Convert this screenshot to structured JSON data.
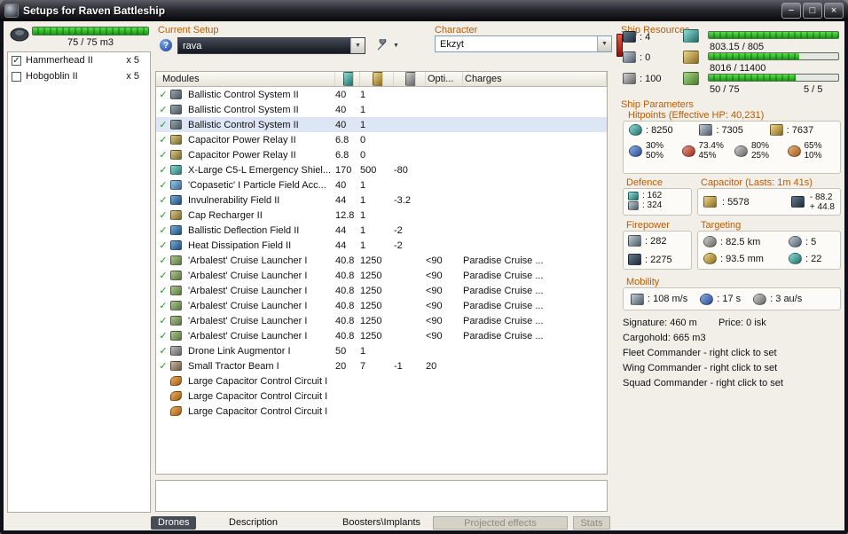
{
  "window": {
    "title": "Setups for Raven Battleship"
  },
  "icons": {
    "help": "?",
    "dropdown_arrow": "▼",
    "checkmark": "✓",
    "minimize": "−",
    "maximize": "□",
    "close": "×"
  },
  "drone_bay": {
    "capacity": "75 / 75 m3",
    "fill_percent": 100,
    "items": [
      {
        "name": "Hammerhead II",
        "qty": "x 5",
        "checked": true
      },
      {
        "name": "Hobgoblin II",
        "qty": "x 5",
        "checked": false
      }
    ]
  },
  "current_setup": {
    "label": "Current Setup",
    "value": "rava"
  },
  "character": {
    "label": "Character",
    "value": "Ekzyt"
  },
  "ship_resources": {
    "label": "Ship Resources",
    "slots": [
      {
        "value": ": 4"
      },
      {
        "value": ": 0"
      },
      {
        "value": ": 100"
      }
    ],
    "bars": [
      {
        "value": "803.15 / 805",
        "percent": 100
      },
      {
        "value": "8016 / 11400",
        "percent": 70
      },
      {
        "value": "50 / 75",
        "percent": 67
      }
    ],
    "rig_slots": "5 / 5"
  },
  "modules": {
    "headers": {
      "modules": "Modules",
      "opti": "Opti...",
      "charges": "Charges"
    },
    "rows": [
      {
        "checked": true,
        "icon": "bcs",
        "name": "Ballistic Control System II",
        "cpu": "40",
        "pg": "1",
        "cap": "",
        "opti": "",
        "charges": ""
      },
      {
        "checked": true,
        "icon": "bcs",
        "name": "Ballistic Control System II",
        "cpu": "40",
        "pg": "1",
        "cap": "",
        "opti": "",
        "charges": ""
      },
      {
        "checked": true,
        "icon": "bcs",
        "name": "Ballistic Control System II",
        "cpu": "40",
        "pg": "1",
        "cap": "",
        "opti": "",
        "charges": "",
        "selected": true
      },
      {
        "checked": true,
        "icon": "cpr",
        "name": "Capacitor Power Relay II",
        "cpu": "6.8",
        "pg": "0",
        "cap": "",
        "opti": "",
        "charges": ""
      },
      {
        "checked": true,
        "icon": "cpr",
        "name": "Capacitor Power Relay II",
        "cpu": "6.8",
        "pg": "0",
        "cap": "",
        "opti": "",
        "charges": ""
      },
      {
        "checked": true,
        "icon": "shield-booster",
        "name": "X-Large C5-L Emergency Shiel...",
        "cpu": "170",
        "pg": "500",
        "cap": "-80",
        "opti": "",
        "charges": ""
      },
      {
        "checked": true,
        "icon": "shield-mod",
        "name": "'Copasetic' I Particle Field Acc...",
        "cpu": "40",
        "pg": "1",
        "cap": "",
        "opti": "",
        "charges": ""
      },
      {
        "checked": true,
        "icon": "hardener",
        "name": "Invulnerability Field II",
        "cpu": "44",
        "pg": "1",
        "cap": "-3.2",
        "opti": "",
        "charges": ""
      },
      {
        "checked": true,
        "icon": "cpr",
        "name": "Cap Recharger II",
        "cpu": "12.8",
        "pg": "1",
        "cap": "",
        "opti": "",
        "charges": ""
      },
      {
        "checked": true,
        "icon": "hardener",
        "name": "Ballistic Deflection Field II",
        "cpu": "44",
        "pg": "1",
        "cap": "-2",
        "opti": "",
        "charges": ""
      },
      {
        "checked": true,
        "icon": "hardener",
        "name": "Heat Dissipation Field II",
        "cpu": "44",
        "pg": "1",
        "cap": "-2",
        "opti": "",
        "charges": ""
      },
      {
        "checked": true,
        "icon": "launcher",
        "name": "'Arbalest' Cruise Launcher I",
        "cpu": "40.8",
        "pg": "1250",
        "cap": "",
        "opti": "<90",
        "charges": "Paradise Cruise ..."
      },
      {
        "checked": true,
        "icon": "launcher",
        "name": "'Arbalest' Cruise Launcher I",
        "cpu": "40.8",
        "pg": "1250",
        "cap": "",
        "opti": "<90",
        "charges": "Paradise Cruise ..."
      },
      {
        "checked": true,
        "icon": "launcher",
        "name": "'Arbalest' Cruise Launcher I",
        "cpu": "40.8",
        "pg": "1250",
        "cap": "",
        "opti": "<90",
        "charges": "Paradise Cruise ..."
      },
      {
        "checked": true,
        "icon": "launcher",
        "name": "'Arbalest' Cruise Launcher I",
        "cpu": "40.8",
        "pg": "1250",
        "cap": "",
        "opti": "<90",
        "charges": "Paradise Cruise ..."
      },
      {
        "checked": true,
        "icon": "launcher",
        "name": "'Arbalest' Cruise Launcher I",
        "cpu": "40.8",
        "pg": "1250",
        "cap": "",
        "opti": "<90",
        "charges": "Paradise Cruise ..."
      },
      {
        "checked": true,
        "icon": "launcher",
        "name": "'Arbalest' Cruise Launcher I",
        "cpu": "40.8",
        "pg": "1250",
        "cap": "",
        "opti": "<90",
        "charges": "Paradise Cruise ..."
      },
      {
        "checked": true,
        "icon": "drone-link",
        "name": "Drone Link Augmentor I",
        "cpu": "50",
        "pg": "1",
        "cap": "",
        "opti": "",
        "charges": ""
      },
      {
        "checked": true,
        "icon": "tractor",
        "name": "Small Tractor Beam I",
        "cpu": "20",
        "pg": "7",
        "cap": "-1",
        "opti": "20",
        "charges": ""
      },
      {
        "checked": false,
        "icon": "rig",
        "name": "Large Capacitor Control Circuit I",
        "cpu": "",
        "pg": "",
        "cap": "",
        "opti": "",
        "charges": ""
      },
      {
        "checked": false,
        "icon": "rig",
        "name": "Large Capacitor Control Circuit I",
        "cpu": "",
        "pg": "",
        "cap": "",
        "opti": "",
        "charges": ""
      },
      {
        "checked": false,
        "icon": "rig",
        "name": "Large Capacitor Control Circuit I",
        "cpu": "",
        "pg": "",
        "cap": "",
        "opti": "",
        "charges": ""
      }
    ]
  },
  "ship_parameters": {
    "label": "Ship Parameters",
    "hitpoints": {
      "label": "Hitpoints (Effective HP: 40,231)",
      "hp": [
        {
          "value": ": 8250"
        },
        {
          "value": ": 7305"
        },
        {
          "value": ": 7637"
        }
      ],
      "resists": [
        {
          "top": "30%",
          "bottom": "50%"
        },
        {
          "top": "73.4%",
          "bottom": "45%"
        },
        {
          "top": "80%",
          "bottom": "25%"
        },
        {
          "top": "65%",
          "bottom": "10%"
        }
      ]
    },
    "defence": {
      "label": "Defence",
      "shield_recharge": ": 162",
      "passive_defence": ": 324"
    },
    "capacitor": {
      "label": "Capacitor (Lasts: 1m 41s)",
      "amount": ": 5578",
      "drain": "- 88.2",
      "recharge": "+ 44.8"
    },
    "firepower": {
      "label": "Firepower",
      "volley": ": 282",
      "dps": ": 2275"
    },
    "targeting": {
      "label": "Targeting",
      "range": ": 82.5 km",
      "max_targets": ": 5",
      "scan_resolution": ": 93.5 mm",
      "sensor_strength": ": 22"
    },
    "mobility": {
      "label": "Mobility",
      "speed": ": 108 m/s",
      "align_time": ": 17 s",
      "warp_speed": ": 3 au/s"
    },
    "signature": "Signature: 460 m",
    "price": "Price: 0 isk",
    "cargohold": "Cargohold: 665 m3",
    "commanders": [
      "Fleet Commander - right click to set",
      "Wing Commander - right click to set",
      "Squad Commander - right click to set"
    ]
  },
  "tabs": [
    {
      "label": "Drones",
      "state": "active"
    },
    {
      "label": "Description",
      "state": "normal"
    },
    {
      "label": "Boosters\\Implants",
      "state": "normal"
    },
    {
      "label": "Projected effects",
      "state": "disabled"
    },
    {
      "label": "Stats",
      "state": "disabled"
    }
  ]
}
